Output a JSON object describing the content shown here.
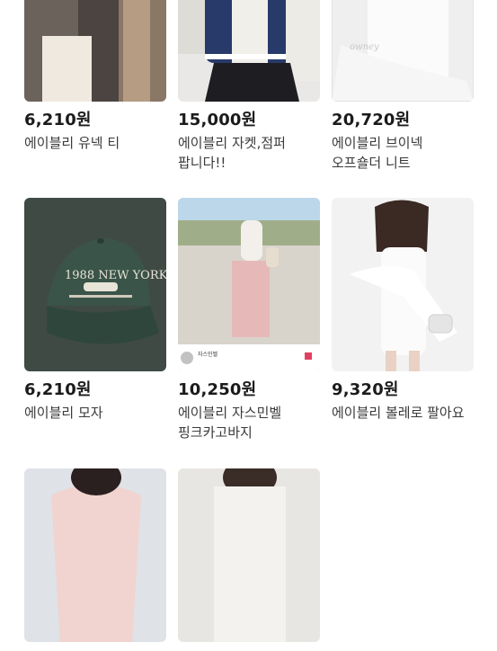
{
  "products": [
    {
      "price": "6,210원",
      "title": "에이블리 유넥 티",
      "image_desc": ""
    },
    {
      "price": "15,000원",
      "title": "에이블리 자켓,점퍼 팝니다!!",
      "image_desc": ""
    },
    {
      "price": "20,720원",
      "title": "에이블리 브이넥 오프숄더 니트",
      "image_desc": "",
      "image_text": "owney"
    },
    {
      "price": "6,210원",
      "title": "에이블리 모자",
      "image_desc": "",
      "image_text": "1988 NEW YORK"
    },
    {
      "price": "10,250원",
      "title": "에이블리 자스민벨 핑크카고바지",
      "image_desc": "",
      "image_text": "자스민벨"
    },
    {
      "price": "9,320원",
      "title": "에이블리 볼레로 팔아요",
      "image_desc": ""
    },
    {
      "price": "",
      "title": "",
      "image_desc": ""
    },
    {
      "price": "",
      "title": "",
      "image_desc": ""
    }
  ]
}
